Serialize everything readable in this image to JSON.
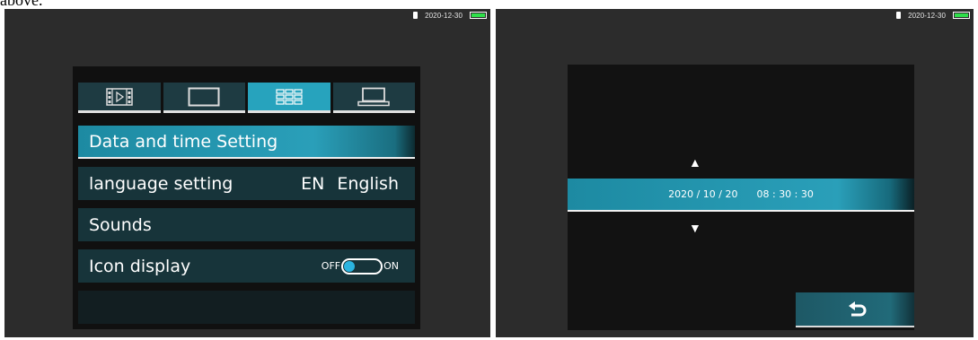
{
  "caption": "above.",
  "status_bar": {
    "date": "2020-12-30",
    "battery_color": "#2ee04a"
  },
  "left_screen": {
    "tabs": [
      {
        "icon": "video-playback-icon",
        "active": false
      },
      {
        "icon": "display-screen-icon",
        "active": false
      },
      {
        "icon": "grid-settings-icon",
        "active": true
      },
      {
        "icon": "laptop-icon",
        "active": false
      }
    ],
    "menu": {
      "date_time": "Data and time Setting",
      "language_label": "language setting",
      "language_value": "EN English",
      "sounds": "Sounds",
      "icon_display": "Icon display",
      "toggle_off": "OFF",
      "toggle_on": "ON"
    },
    "accent_color": "#27a3bd"
  },
  "right_screen": {
    "up_arrow": "▲",
    "down_arrow": "▼",
    "date": {
      "year": "2020",
      "month": "10",
      "day": "20"
    },
    "time": {
      "hour": "08",
      "minute": "30",
      "second": "30"
    },
    "back_icon": "return-arrow-icon"
  }
}
